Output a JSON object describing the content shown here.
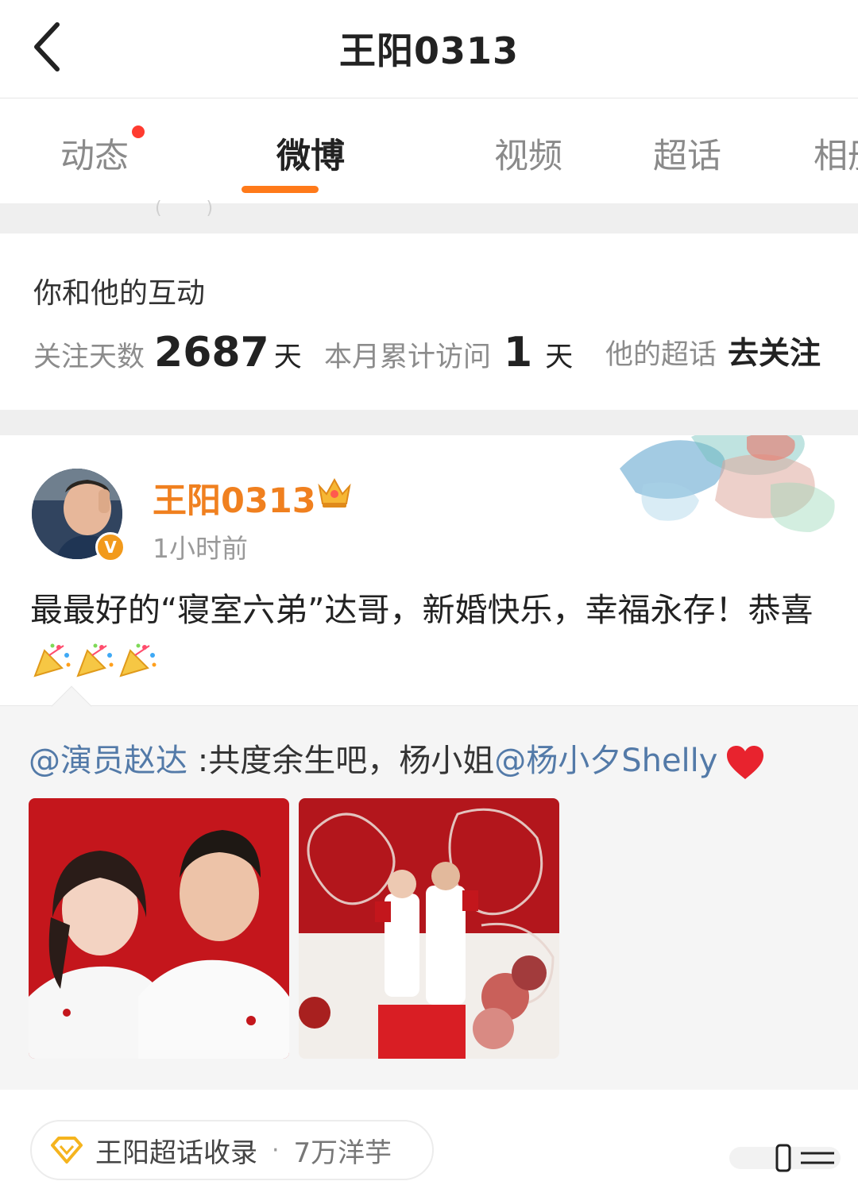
{
  "header": {
    "title": "王阳0313"
  },
  "tabs": [
    {
      "label": "动态",
      "has_badge": true
    },
    {
      "label": "微博",
      "active": true
    },
    {
      "label": "视频"
    },
    {
      "label": "超话"
    },
    {
      "label": "相册"
    }
  ],
  "interaction": {
    "title": "你和他的互动",
    "follow_days_label": "关注天数",
    "follow_days_value": "2687",
    "follow_days_unit": "天",
    "monthly_visits_label": "本月累计访问",
    "monthly_visits_value": "1",
    "monthly_visits_unit": "天",
    "super_topic_label": "他的超话",
    "super_topic_action": "去关注"
  },
  "post": {
    "author": "王阳0313",
    "time": "1小时前",
    "text": "最最好的“寝室六弟”达哥，新婚快乐，幸福永存！恭喜",
    "emoji": "party-popper-icon",
    "emoji_count": 3
  },
  "repost": {
    "mention": "@演员赵达",
    "text": " :共度余生吧，杨小姐",
    "mention2": "@杨小夕Shelly",
    "emoji": "heart-icon"
  },
  "footer": {
    "chip_label": "王阳超话收录",
    "chip_separator": "·",
    "chip_count": "7万洋芋"
  },
  "colors": {
    "accent": "#ff7a1a",
    "badge_red": "#ff3b30",
    "author_orange": "#f0801f",
    "link_blue": "#537aa8",
    "verify_orange": "#f29a1c"
  }
}
